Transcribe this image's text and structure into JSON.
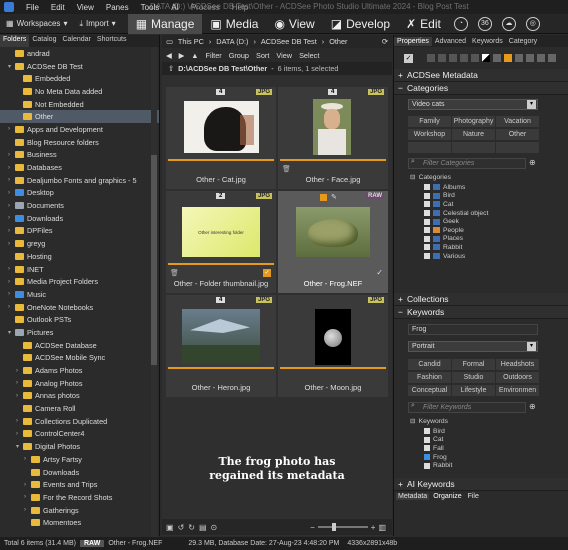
{
  "titlebar": {
    "menus": [
      "File",
      "Edit",
      "View",
      "Panes",
      "Tools",
      "AI",
      "Process",
      "Help"
    ],
    "title": "DATA (D:) \\ACDSee DB Test\\Other - ACDSee Photo Studio Ultimate 2024 - Blog Post Test"
  },
  "toolbar": {
    "workspaces": "Workspaces",
    "import": "Import",
    "modes": [
      "Manage",
      "Media",
      "View",
      "Develop",
      "Edit"
    ]
  },
  "left": {
    "tabs": [
      "Folders",
      "Catalog",
      "Calendar",
      "Shortcuts"
    ],
    "tree": [
      {
        "label": "andrad",
        "depth": 2,
        "arrow": "",
        "ic": "folder"
      },
      {
        "label": "ACDSee DB Test",
        "depth": 2,
        "arrow": "▾",
        "ic": "folder"
      },
      {
        "label": "Embedded",
        "depth": 3,
        "arrow": "",
        "ic": "folder"
      },
      {
        "label": "No Meta Data added",
        "depth": 3,
        "arrow": "",
        "ic": "folder"
      },
      {
        "label": "Not Embedded",
        "depth": 3,
        "arrow": "",
        "ic": "folder"
      },
      {
        "label": "Other",
        "depth": 3,
        "arrow": "",
        "ic": "folder",
        "sel": true
      },
      {
        "label": "Apps and Development",
        "depth": 2,
        "arrow": "›",
        "ic": "folder"
      },
      {
        "label": "Blog Resource folders",
        "depth": 2,
        "arrow": "",
        "ic": "folder"
      },
      {
        "label": "Business",
        "depth": 2,
        "arrow": "›",
        "ic": "folder"
      },
      {
        "label": "Databases",
        "depth": 2,
        "arrow": "›",
        "ic": "folder"
      },
      {
        "label": "Dealjumbo Fonts and graphics - 5",
        "depth": 2,
        "arrow": "›",
        "ic": "folder"
      },
      {
        "label": "Desktop",
        "depth": 2,
        "arrow": "›",
        "ic": "blue"
      },
      {
        "label": "Documents",
        "depth": 2,
        "arrow": "›",
        "ic": "gray"
      },
      {
        "label": "Downloads",
        "depth": 2,
        "arrow": "›",
        "ic": "blue"
      },
      {
        "label": "DPFiles",
        "depth": 2,
        "arrow": "›",
        "ic": "folder"
      },
      {
        "label": "greyg",
        "depth": 2,
        "arrow": "›",
        "ic": "folder"
      },
      {
        "label": "Hosting",
        "depth": 2,
        "arrow": "",
        "ic": "folder"
      },
      {
        "label": "INET",
        "depth": 2,
        "arrow": "›",
        "ic": "folder"
      },
      {
        "label": "Media Project Folders",
        "depth": 2,
        "arrow": "›",
        "ic": "folder"
      },
      {
        "label": "Music",
        "depth": 2,
        "arrow": "›",
        "ic": "blue"
      },
      {
        "label": "OneNote Notebooks",
        "depth": 2,
        "arrow": "›",
        "ic": "folder"
      },
      {
        "label": "Outlook PSTs",
        "depth": 2,
        "arrow": "",
        "ic": "folder"
      },
      {
        "label": "Pictures",
        "depth": 2,
        "arrow": "▾",
        "ic": "gray"
      },
      {
        "label": "ACDSee Database",
        "depth": 3,
        "arrow": "",
        "ic": "folder"
      },
      {
        "label": "ACDSee Mobile Sync",
        "depth": 3,
        "arrow": "",
        "ic": "folder"
      },
      {
        "label": "Adams Photos",
        "depth": 3,
        "arrow": "›",
        "ic": "folder"
      },
      {
        "label": "Analog Photos",
        "depth": 3,
        "arrow": "›",
        "ic": "folder"
      },
      {
        "label": "Annas photos",
        "depth": 3,
        "arrow": "›",
        "ic": "folder"
      },
      {
        "label": "Camera Roll",
        "depth": 3,
        "arrow": "",
        "ic": "folder"
      },
      {
        "label": "Collections Duplicated",
        "depth": 3,
        "arrow": "›",
        "ic": "folder"
      },
      {
        "label": "ControlCenter4",
        "depth": 3,
        "arrow": "›",
        "ic": "folder"
      },
      {
        "label": "Digital Photos",
        "depth": 3,
        "arrow": "▾",
        "ic": "folder"
      },
      {
        "label": "Artsy Fartsy",
        "depth": 4,
        "arrow": "›",
        "ic": "folder"
      },
      {
        "label": "Downloads",
        "depth": 4,
        "arrow": "",
        "ic": "folder"
      },
      {
        "label": "Events and Trips",
        "depth": 4,
        "arrow": "›",
        "ic": "folder"
      },
      {
        "label": "For the Record Shots",
        "depth": 4,
        "arrow": "›",
        "ic": "folder"
      },
      {
        "label": "Gatherings",
        "depth": 4,
        "arrow": "›",
        "ic": "folder"
      },
      {
        "label": "Momentoes",
        "depth": 4,
        "arrow": "",
        "ic": "folder"
      }
    ]
  },
  "center": {
    "path": [
      "This PC",
      "DATA (D:)",
      "ACDSee DB Test",
      "Other"
    ],
    "filters": [
      "Filter",
      "Group",
      "Sort",
      "View",
      "Select"
    ],
    "location": "D:\\ACDSee DB Test\\Other",
    "count": "6 items, 1 selected",
    "items": [
      {
        "num": "4",
        "fmt": "JPG",
        "caption": "Other - Cat.jpg"
      },
      {
        "num": "4",
        "fmt": "JPG",
        "caption": "Other - Face.jpg"
      },
      {
        "num": "2",
        "fmt": "JPG",
        "caption": "Other - Folder thumbnail.jpg",
        "thumb_text": "Other interesting folder"
      },
      {
        "num": "",
        "fmt": "RAW",
        "caption": "Other - Frog.NEF"
      },
      {
        "num": "4",
        "fmt": "JPG",
        "caption": "Other - Heron.jpg"
      },
      {
        "num": "",
        "fmt": "JPG",
        "caption": "Other - Moon.jpg"
      }
    ],
    "overlay": [
      "The frog photo has",
      "regained its metadata"
    ]
  },
  "right": {
    "tabs": [
      "Properties",
      "Advanced",
      "Keywords",
      "Category"
    ],
    "sections": {
      "metadata": "ACDSee Metadata",
      "categories": "Categories",
      "collections": "Collections",
      "keywords": "Keywords",
      "ai": "AI Keywords"
    },
    "cat_set": "Video cats",
    "cat_buttons": [
      "Family",
      "Photography",
      "Vacation",
      "Workshop",
      "Nature",
      "Other"
    ],
    "cat_search": "Filter Categories",
    "cat_tree_root": "Categories",
    "cat_items": [
      "Albums",
      "Bird",
      "Cat",
      "Celestial object",
      "Geek",
      "People",
      "Places",
      "Rabbit",
      "Various"
    ],
    "kw_value": "Frog",
    "kw_set": "Portrait",
    "kw_buttons": [
      "Candid",
      "Formal",
      "Headshots",
      "Fashion",
      "Studio",
      "Outdoors",
      "Conceptual",
      "Lifestyle",
      "Environmen"
    ],
    "kw_search": "Filter Keywords",
    "kw_tree_root": "Keywords",
    "kw_items": [
      "Bird",
      "Cat",
      "Fall",
      "Frog",
      "Rabbit"
    ],
    "bottom_tabs": [
      "Metadata",
      "Organize",
      "File"
    ]
  },
  "status": {
    "total": "Total 6 items (31.4 MB)",
    "type": "RAW",
    "file": "Other - Frog.NEF",
    "info": "29.3 MB, Database Date: 27-Aug-23 4:48:20 PM",
    "dims": "4336x2891x48b"
  }
}
